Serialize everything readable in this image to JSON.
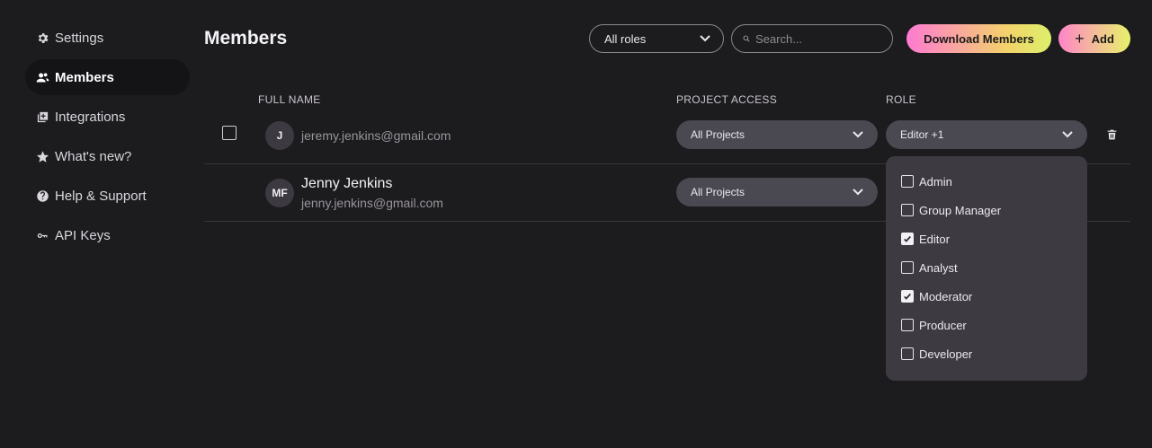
{
  "sidebar": {
    "items": [
      {
        "label": "Settings",
        "icon": "gear-icon"
      },
      {
        "label": "Members",
        "icon": "people-icon",
        "active": true
      },
      {
        "label": "Integrations",
        "icon": "plus-box-icon"
      },
      {
        "label": "What's new?",
        "icon": "star-icon"
      },
      {
        "label": "Help & Support",
        "icon": "help-icon"
      },
      {
        "label": "API Keys",
        "icon": "key-icon"
      }
    ]
  },
  "header": {
    "title": "Members",
    "role_filter": "All roles",
    "search_placeholder": "Search...",
    "download_label": "Download Members",
    "add_label": "Add"
  },
  "table": {
    "columns": {
      "name": "FULL NAME",
      "access": "PROJECT ACCESS",
      "role": "ROLE"
    },
    "rows": [
      {
        "initials": "J",
        "name": "",
        "email": "jeremy.jenkins@gmail.com",
        "access": "All Projects",
        "role": "Editor +1"
      },
      {
        "initials": "MF",
        "name": "Jenny Jenkins",
        "email": "jenny.jenkins@gmail.com",
        "access": "All Projects"
      }
    ]
  },
  "role_dropdown": {
    "options": [
      {
        "label": "Admin",
        "checked": false
      },
      {
        "label": "Group Manager",
        "checked": false
      },
      {
        "label": "Editor",
        "checked": true
      },
      {
        "label": "Analyst",
        "checked": false
      },
      {
        "label": "Moderator",
        "checked": true
      },
      {
        "label": "Producer",
        "checked": false
      },
      {
        "label": "Developer",
        "checked": false
      }
    ]
  },
  "colors": {
    "background": "#1c1b1e",
    "pill": "#4a4850",
    "dropdown": "#3d3b41",
    "accent_start": "#ff7ad2",
    "accent_end": "#dcf06a"
  }
}
